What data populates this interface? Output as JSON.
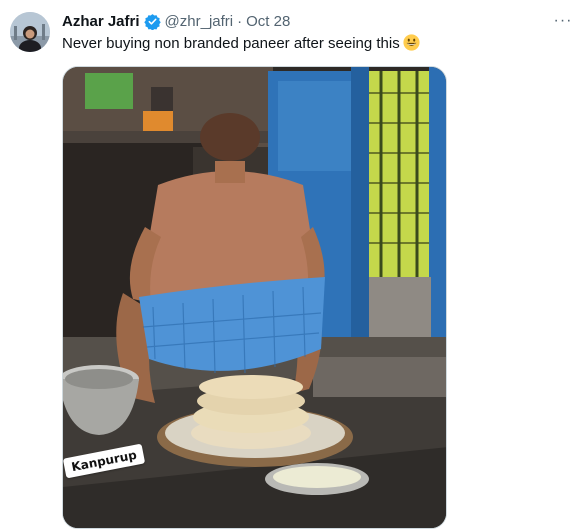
{
  "tweet": {
    "author_name": "Azhar Jafri",
    "handle": "@zhr_jafri",
    "separator": "·",
    "date": "Oct 28",
    "text": "Never buying non branded paneer after seeing this",
    "more_label": "···"
  },
  "media": {
    "overlay_text": "Kanpurup"
  },
  "colors": {
    "verified_badge": "#1d9bf0",
    "handle_gray": "#536471",
    "door_blue": "#2f73b8",
    "lungi_blue": "#4f93d6",
    "wall_green": "#c4d84b"
  }
}
